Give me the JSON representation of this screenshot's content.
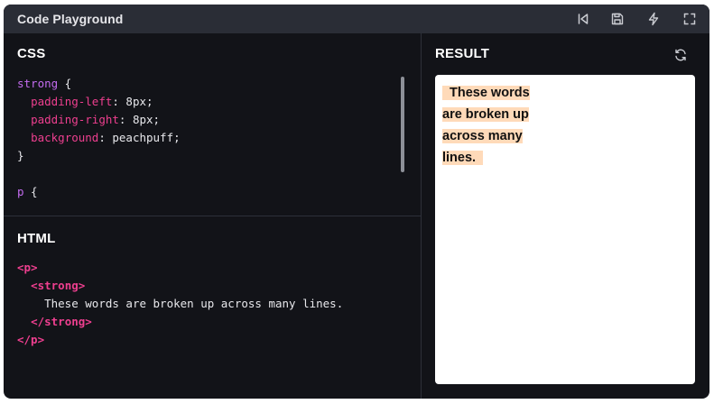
{
  "window": {
    "title": "Code Playground",
    "toolbar": {
      "reset_icon": "skip-back-icon",
      "save_icon": "save-icon",
      "format_icon": "lightning-icon",
      "fullscreen_icon": "fullscreen-icon"
    }
  },
  "css_panel": {
    "title": "CSS",
    "lines": [
      {
        "selector": "strong",
        "brace": " {"
      },
      {
        "prop": "padding-left",
        "value": ": 8px;"
      },
      {
        "prop": "padding-right",
        "value": ": 8px;"
      },
      {
        "prop": "background",
        "value": ": peachpuff;"
      },
      {
        "close": "}"
      },
      {
        "blank": ""
      },
      {
        "selector": "p",
        "brace": " {"
      }
    ]
  },
  "html_panel": {
    "title": "HTML",
    "line1": "<p>",
    "line2": "<strong>",
    "line3": "These words are broken up across many lines.",
    "line4": "</strong>",
    "line5": "</p>"
  },
  "result_panel": {
    "title": "RESULT",
    "refresh_icon": "refresh-icon",
    "rendered_text": "These words are broken up across many lines."
  },
  "colors": {
    "window_bg": "#121318",
    "titlebar_bg": "#2a2d36",
    "selector_color": "#c46cf0",
    "property_color": "#ee3f8f",
    "highlight": "peachpuff"
  }
}
